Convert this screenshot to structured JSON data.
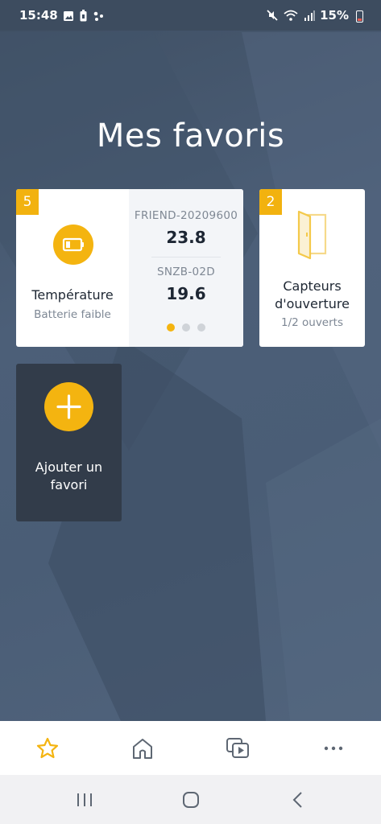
{
  "status_bar": {
    "time": "15:48",
    "battery": "15%",
    "icons_left": [
      "image-icon",
      "battery-saver-icon",
      "dots-icon"
    ],
    "icons_right": [
      "mute-icon",
      "wifi-icon",
      "signal-icon"
    ]
  },
  "page": {
    "title": "Mes favoris"
  },
  "favorites": {
    "temperature": {
      "badge": "5",
      "icon": "battery-low-icon",
      "title": "Température",
      "subtitle": "Batterie faible",
      "sensors": [
        {
          "name": "FRIEND-20209600",
          "value": "23.8"
        },
        {
          "name": "SNZB-02D",
          "value": "19.6"
        }
      ],
      "pagination": {
        "count": 3,
        "active": 0
      }
    },
    "doors": {
      "badge": "2",
      "icon": "door-open-icon",
      "title_line1": "Capteurs",
      "title_line2": "d'ouverture",
      "subtitle": "1/2 ouverts"
    },
    "add": {
      "icon": "plus-icon",
      "label_line1": "Ajouter un",
      "label_line2": "favori"
    }
  },
  "tab_bar": {
    "tabs": [
      {
        "icon": "star-icon",
        "active": true
      },
      {
        "icon": "home-icon",
        "active": false
      },
      {
        "icon": "media-icon",
        "active": false
      },
      {
        "icon": "more-icon",
        "active": false
      }
    ]
  },
  "colors": {
    "accent": "#f4b410",
    "card": "#ffffff",
    "add_card": "#323c4a",
    "background": "#4a5d76"
  }
}
